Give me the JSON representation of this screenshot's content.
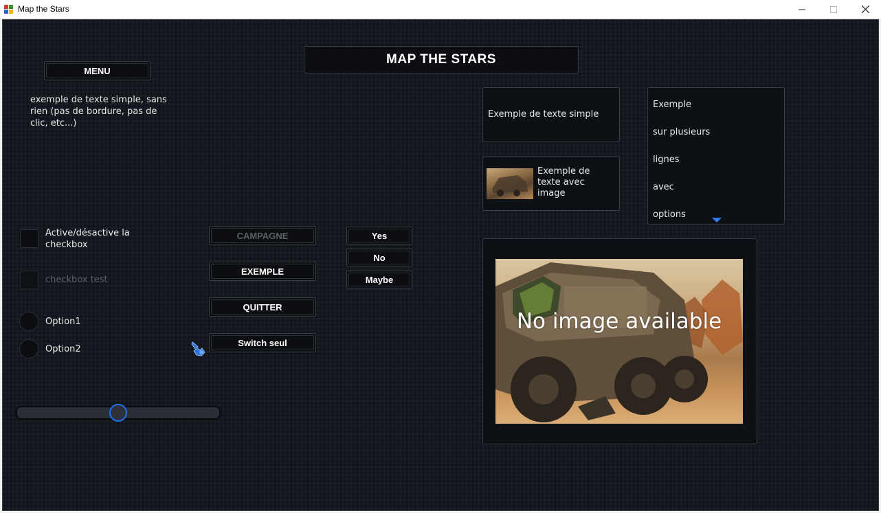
{
  "window": {
    "title": "Map the Stars"
  },
  "header": {
    "title": "MAP THE STARS"
  },
  "menu": {
    "label": "MENU"
  },
  "plain_text": "exemple de texte simple, sans rien (pas de bordure, pas de clic, etc...)",
  "checkboxes": [
    {
      "label": "Active/désactive la checkbox",
      "enabled": true,
      "checked": false
    },
    {
      "label": "checkbox test",
      "enabled": false,
      "checked": false
    }
  ],
  "radios": [
    {
      "label": "Option1",
      "selected": false
    },
    {
      "label": "Option2",
      "selected": false
    }
  ],
  "buttons": {
    "campagne": "CAMPAGNE",
    "exemple": "EXEMPLE",
    "quitter": "QUITTER",
    "switch": "Switch seul"
  },
  "choices": [
    "Yes",
    "No",
    "Maybe"
  ],
  "text_panel": {
    "text": "Exemple de texte simple"
  },
  "image_text_panel": {
    "text": "Exemple de texte avec image"
  },
  "list": {
    "items": [
      "Exemple",
      "sur plusieurs",
      "lignes",
      "avec",
      "options"
    ]
  },
  "image_panel": {
    "overlay_text": "No image available"
  },
  "slider": {
    "value": 0.5
  },
  "colors": {
    "accent": "#1f6fe8",
    "background": "#15191f"
  },
  "icons": [
    "app-icon",
    "minimize-icon",
    "maximize-icon",
    "close-icon",
    "pointer-hand-icon",
    "scroll-down-arrow-icon"
  ]
}
